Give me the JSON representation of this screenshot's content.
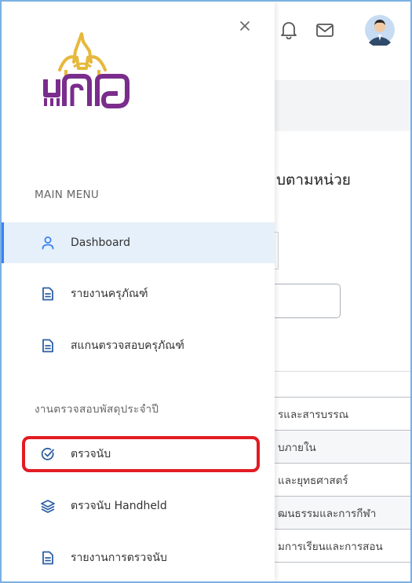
{
  "header": {
    "icons": [
      "bell-icon",
      "mail-icon",
      "user-avatar"
    ]
  },
  "drawer": {
    "close_label": "×",
    "main_menu_title": "MAIN MENU",
    "main_items": [
      {
        "label": "Dashboard",
        "icon": "user-icon"
      },
      {
        "label": "รายงานครุภัณฑ์",
        "icon": "document-icon"
      },
      {
        "label": "สแกนตรวจสอบครุภัณฑ์",
        "icon": "document-icon"
      }
    ],
    "section2_title": "งานตรวจสอบพัสดุประจำปี",
    "section2_items": [
      {
        "label": "ตรวจนับ",
        "icon": "check-circle-icon"
      },
      {
        "label": "ตรวจนับ Handheld",
        "icon": "layers-icon"
      },
      {
        "label": "รายงานการตรวจนับ",
        "icon": "document-icon"
      }
    ]
  },
  "background": {
    "heading": "บตามหน่วย",
    "rows": [
      "รและสารบรรณ",
      "บภายใน",
      "และยุทธศาสตร์",
      "ฒนธรรมและการกีฬา",
      "มการเรียนและการสอน"
    ]
  },
  "colors": {
    "accent": "#3b82f6",
    "active_bg": "#e6f0fa",
    "logo_gold": "#e6b83c",
    "logo_purple": "#7a2d8c",
    "highlight": "#e21b23"
  }
}
